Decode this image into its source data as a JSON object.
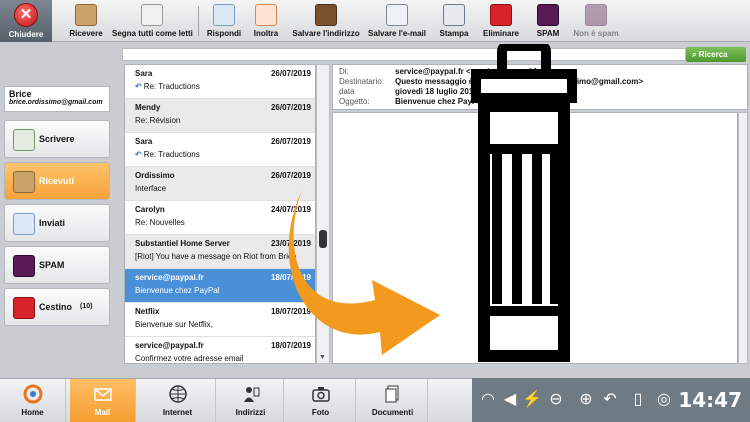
{
  "toolbar": {
    "close_label": "Chiudere",
    "buttons": [
      {
        "label": "Ricevere",
        "icon": "inbox-download-icon"
      },
      {
        "label": "Segna tutti come letti",
        "icon": "mark-read-icon"
      },
      {
        "label": "Rispondi",
        "icon": "reply-icon"
      },
      {
        "label": "Inoltra",
        "icon": "forward-icon"
      },
      {
        "label": "Salvare l'indirizzo",
        "icon": "address-book-icon"
      },
      {
        "label": "Salvare l'e-mail",
        "icon": "save-email-icon"
      },
      {
        "label": "Stampa",
        "icon": "printer-icon"
      },
      {
        "label": "Eliminare",
        "icon": "trash-icon"
      },
      {
        "label": "SPAM",
        "icon": "spam-icon"
      },
      {
        "label": "Non è spam",
        "icon": "not-spam-icon"
      }
    ]
  },
  "search": {
    "button_label": "Ricerca",
    "placeholder": ""
  },
  "user": {
    "name": "Brice",
    "email": "brice.ordissimo@gmail.com"
  },
  "folders": [
    {
      "label": "Scrivere",
      "icon": "compose-icon"
    },
    {
      "label": "Ricevuti",
      "icon": "inbox-icon"
    },
    {
      "label": "Inviati",
      "icon": "sent-icon"
    },
    {
      "label": "SPAM",
      "icon": "spam-icon"
    },
    {
      "label": "Cestino",
      "count": "(10)",
      "icon": "trash-icon"
    }
  ],
  "messages": [
    {
      "from": "Sara",
      "date": "26/07/2019",
      "subject": "Re: Traductions",
      "replied": true
    },
    {
      "from": "Mendy",
      "date": "26/07/2019",
      "subject": "Re: Révision",
      "replied": false
    },
    {
      "from": "Sara",
      "date": "26/07/2019",
      "subject": "Re: Traductions",
      "replied": true
    },
    {
      "from": "Ordissimo",
      "date": "26/07/2019",
      "subject": "Interface",
      "replied": false
    },
    {
      "from": "Carolyn",
      "date": "24/07/2019",
      "subject": "Re: Nouvelles",
      "replied": false
    },
    {
      "from": "Substantiel Home Server",
      "date": "23/07/2019",
      "subject": "[Riot] You have a message on Riot from Brice",
      "replied": false
    },
    {
      "from": "service@paypal.fr",
      "date": "18/07/2019",
      "subject": "Bienvenue chez PayPal",
      "replied": false
    },
    {
      "from": "Netflix",
      "date": "18/07/2019",
      "subject": "Bienvenue sur Netflix,",
      "replied": false
    },
    {
      "from": "service@paypal.fr",
      "date": "18/07/2019",
      "subject": "Confirmez votre adresse email",
      "replied": false
    }
  ],
  "message_header": {
    "from_key": "Di:",
    "from_val": "service@paypal.fr <service@paypal.fr>",
    "to_key": "Destinatario:",
    "to_val": "Questo messaggio è stato inviato a brice.ordissimo@gmail.com>",
    "date_key": "data",
    "date_val": "giovedì 18 luglio 2019 13:15",
    "subject_key": "Oggetto:",
    "subject_val": "Bienvenue chez PayPal"
  },
  "taskbar": [
    {
      "label": "Home",
      "icon": "home-icon"
    },
    {
      "label": "Mail",
      "icon": "mail-icon"
    },
    {
      "label": "Internet",
      "icon": "globe-icon"
    },
    {
      "label": "Indirizzi",
      "icon": "contacts-icon"
    },
    {
      "label": "Foto",
      "icon": "camera-icon"
    },
    {
      "label": "Documenti",
      "icon": "documents-icon"
    }
  ],
  "clock": "14:47",
  "colors": {
    "accent_orange": "#f5a33a",
    "selection_blue": "#4a90d9",
    "search_green": "#4b9a2e",
    "close_red": "#c41414"
  }
}
